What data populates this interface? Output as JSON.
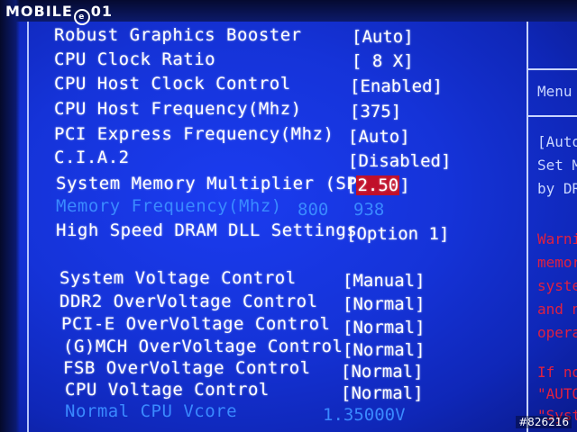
{
  "logo": {
    "text_a": "MOBILE",
    "circle_char": "e",
    "text_b": "01"
  },
  "settings": [
    {
      "label": "Robust Graphics Booster",
      "value": "[Auto]"
    },
    {
      "label": "CPU Clock Ratio",
      "value": "[ 8 X]"
    },
    {
      "label": "CPU Host Clock Control",
      "value": "[Enabled]"
    },
    {
      "label": "CPU Host Frequency(Mhz)",
      "value": "[375]"
    },
    {
      "label": "PCI Express Frequency(Mhz)",
      "value": "[Auto]"
    },
    {
      "label": "C.I.A.2",
      "value": "[Disabled]"
    },
    {
      "label": "System Memory Multiplier (SPD)",
      "value_open": "[",
      "value_selected": "2.50",
      "value_close": "]"
    },
    {
      "label": "Memory Frequency(Mhz)",
      "value_a": "800",
      "value_b": "938"
    },
    {
      "label": "High Speed DRAM DLL Settings",
      "value": "[Option 1]"
    },
    {
      "label": "System Voltage Control",
      "value": "[Manual]"
    },
    {
      "label": "DDR2 OverVoltage Control",
      "value": "[Normal]"
    },
    {
      "label": "PCI-E OverVoltage Control",
      "value": "[Normal]"
    },
    {
      "label": "(G)MCH OverVoltage Control",
      "value": "[Normal]"
    },
    {
      "label": "FSB OverVoltage Control",
      "value": "[Normal]"
    },
    {
      "label": "CPU Voltage Control",
      "value": "[Normal]"
    },
    {
      "label": "Normal CPU Vcore",
      "value": "1.35000V"
    }
  ],
  "help_panel": {
    "title": "Menu",
    "lines": [
      "[Auto",
      "Set M",
      "by DR"
    ],
    "warning_lines": [
      "Warni",
      "memory",
      "system",
      "and no",
      "operat"
    ],
    "footer_lines": [
      "If not",
      "\"AUTO\",",
      "\"System"
    ]
  },
  "watermark": "#826216",
  "colors": {
    "background": "#1533d8",
    "text": "#ffffff",
    "disabled_text": "#3a8aff",
    "highlight": "#c0102a",
    "warning": "#e02040"
  }
}
